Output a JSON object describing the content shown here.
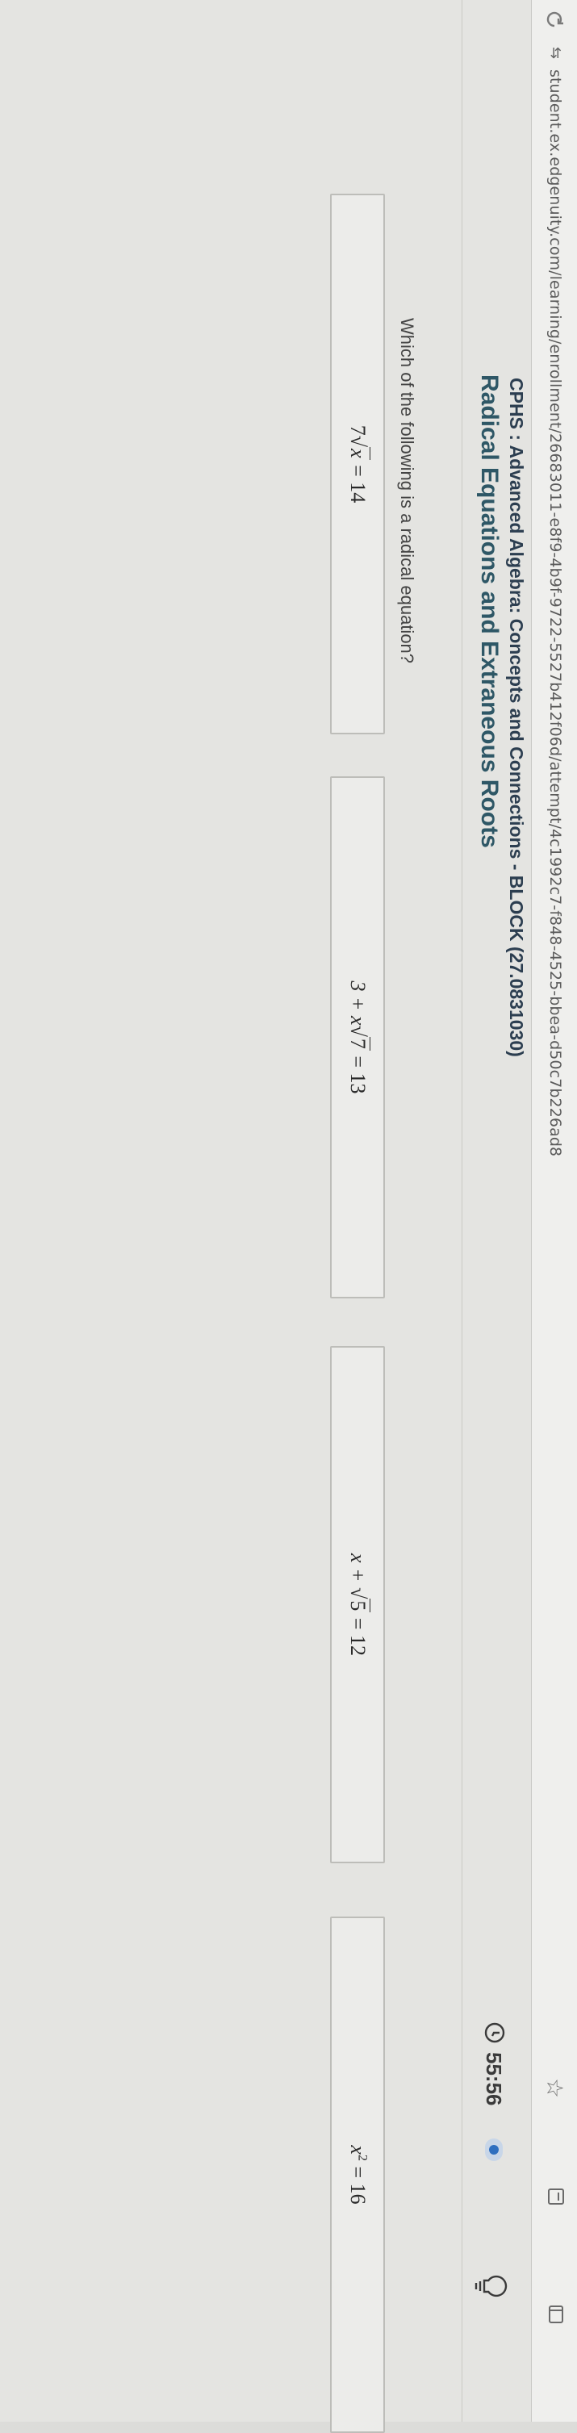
{
  "browser": {
    "url": "student.ex.edgenuity.com/learning/enrollment/26683011-e8f9-4b9f-9722-5527b412f06d/attempt/4c1992c7-f848-4525-bbea-d50c7b226ad8",
    "icons": {
      "reload": "reload-icon",
      "site": "site-settings-icon",
      "bookmark": "star-icon",
      "reader": "reader-icon",
      "share": "share-icon"
    }
  },
  "header": {
    "course": "CPHS : Advanced Algebra: Concepts and Connections - BLOCK (27.0831030)",
    "lesson": "Radical Equations and Extraneous Roots",
    "timer": "55:56",
    "accent": "#2f6fbf"
  },
  "question": {
    "prompt": "Which of the following is a radical equation?",
    "options": [
      {
        "before": "7",
        "radicand": "x",
        "after": " = 14"
      },
      {
        "before": "3 + x",
        "radicand": "7",
        "after": " = 13"
      },
      {
        "before": "x + ",
        "radicand": "5",
        "after": " = 12"
      },
      {
        "base": "x",
        "exp": "2",
        "after": " = 16"
      }
    ]
  }
}
